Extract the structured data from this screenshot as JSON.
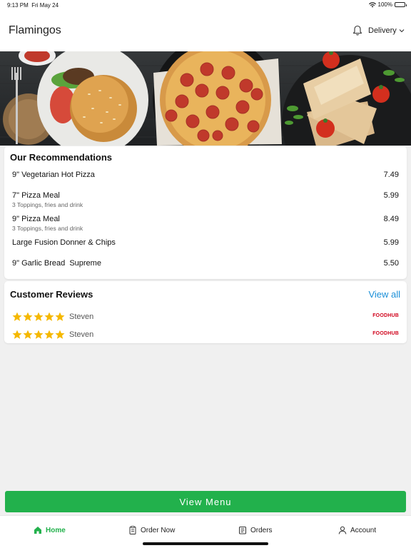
{
  "status_bar": {
    "time": "9:13 PM",
    "date": "Fri May 24",
    "battery": "100%",
    "battery_level": 1.0
  },
  "header": {
    "title": "Flamingos",
    "mode": "Delivery",
    "bell_icon": "bell-icon",
    "dropdown_icon": "chevron-down-icon"
  },
  "recommendations": {
    "title": "Our Recommendations",
    "items": [
      {
        "name": "9\" Vegetarian Hot Pizza",
        "description": "",
        "price": "7.49"
      },
      {
        "name": "7\" Pizza Meal",
        "description": "3 Toppings, fries and drink",
        "price": "5.99"
      },
      {
        "name": "9\" Pizza Meal",
        "description": "3 Toppings, fries and drink",
        "price": "8.49"
      },
      {
        "name": "Large Fusion Donner & Chips",
        "description": "",
        "price": "5.99"
      },
      {
        "name": "9\" Garlic Bread  Supreme",
        "description": "",
        "price": "5.50"
      }
    ]
  },
  "reviews": {
    "title": "Customer Reviews",
    "view_all": "View all",
    "items": [
      {
        "reviewer": "Steven",
        "rating": 5,
        "source": "FOODHUB"
      },
      {
        "reviewer": "Steven",
        "rating": 5,
        "source": "FOODHUB"
      }
    ]
  },
  "view_menu_label": "View Menu",
  "tabs": [
    {
      "label": "Home",
      "icon": "home-icon",
      "active": true
    },
    {
      "label": "Order Now",
      "icon": "clipboard-icon",
      "active": false
    },
    {
      "label": "Orders",
      "icon": "receipt-icon",
      "active": false
    },
    {
      "label": "Account",
      "icon": "person-icon",
      "active": false
    }
  ],
  "colors": {
    "accent_green": "#22b14c",
    "link_blue": "#1a8fd8",
    "star_gold": "#f5b800",
    "foodhub_red": "#d0021b"
  }
}
